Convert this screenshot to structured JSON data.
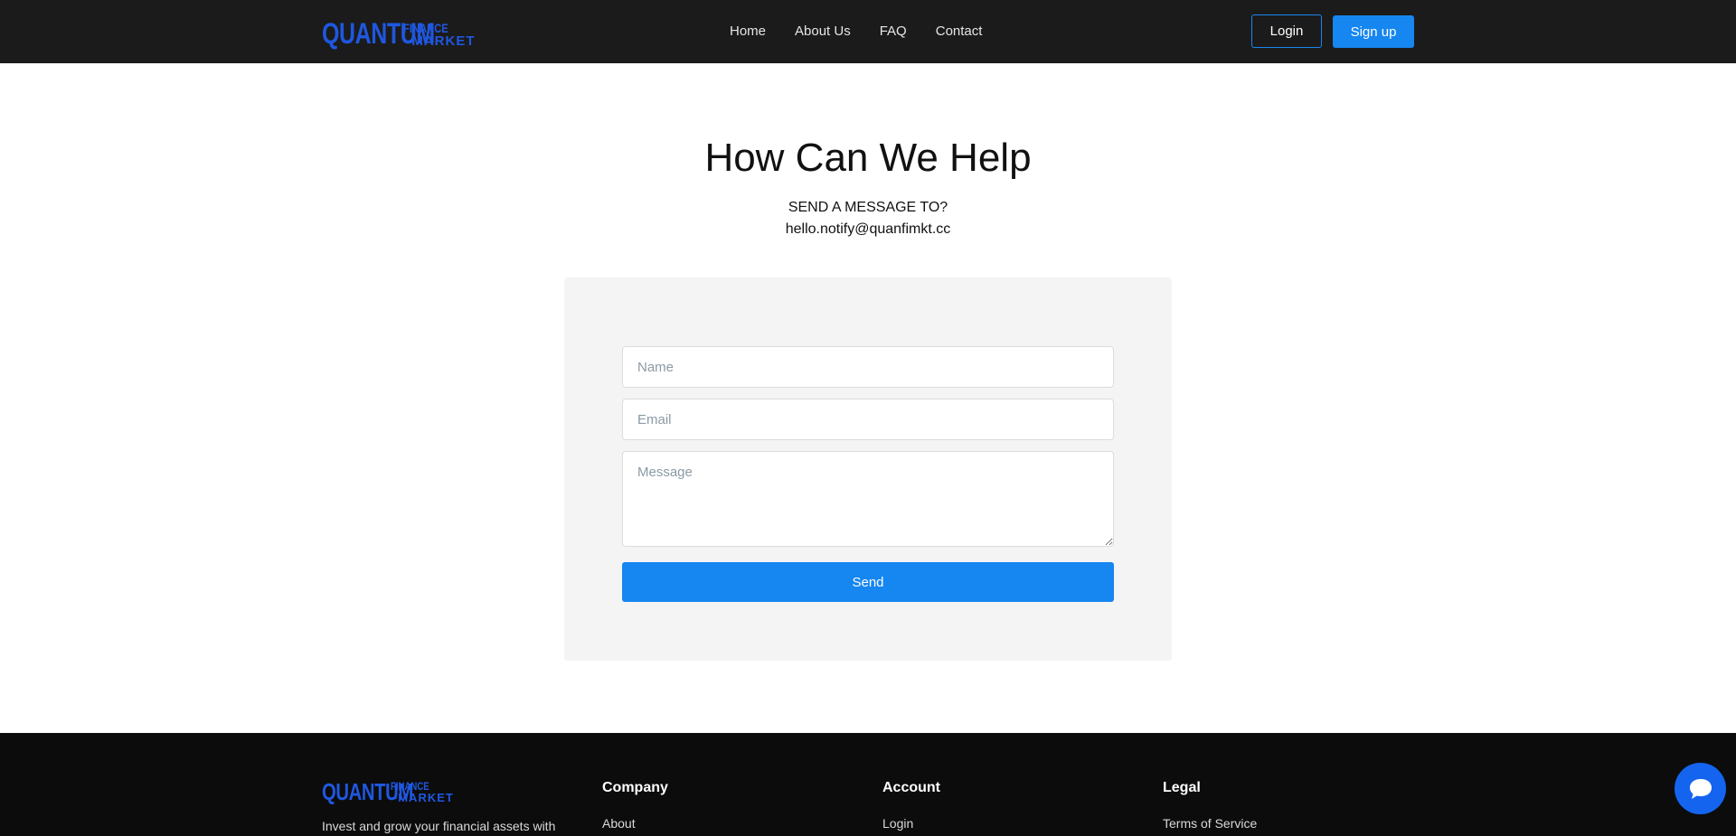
{
  "header": {
    "logo": {
      "main": "QUANTUM",
      "top": "FINANCE",
      "bottom": "–MARKET"
    },
    "nav": [
      "Home",
      "About Us",
      "FAQ",
      "Contact"
    ],
    "login_label": "Login",
    "signup_label": "Sign up"
  },
  "main": {
    "title": "How Can We Help",
    "subtitle": "SEND A MESSAGE TO?",
    "email": "hello.notify@quanfimkt.cc",
    "form": {
      "name_placeholder": "Name",
      "email_placeholder": "Email",
      "message_placeholder": "Message",
      "send_label": "Send"
    }
  },
  "footer": {
    "logo": {
      "main": "QUANTUM",
      "top": "FINANCE",
      "bottom": "–MARKET"
    },
    "tagline": "Invest and grow your financial assets with",
    "columns": [
      {
        "heading": "Company",
        "first_link": "About"
      },
      {
        "heading": "Account",
        "first_link": "Login"
      },
      {
        "heading": "Legal",
        "first_link": "Terms of Service"
      }
    ]
  },
  "chat": {
    "icon": "chat-bubble-icon"
  },
  "colors": {
    "header_bg": "#1b1b1b",
    "accent": "#1686f0",
    "logo": "#1f57e0",
    "card_bg": "#f4f4f4",
    "footer_bg": "#0c0c0c",
    "chat_bg": "#1464f0"
  }
}
